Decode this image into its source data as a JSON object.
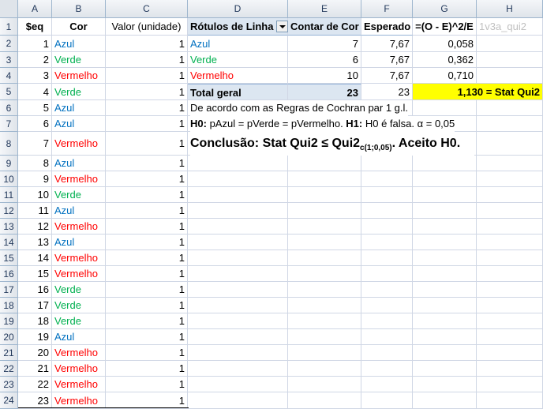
{
  "columns": [
    "A",
    "B",
    "C",
    "D",
    "E",
    "F",
    "G",
    "H"
  ],
  "rows": [
    "1",
    "2",
    "3",
    "4",
    "5",
    "6",
    "7",
    "8",
    "9",
    "10",
    "11",
    "12",
    "13",
    "14",
    "15",
    "16",
    "17",
    "18",
    "19",
    "20",
    "21",
    "22",
    "23",
    "24"
  ],
  "headers": {
    "seq": "$eq",
    "cor": "Cor",
    "valor": "Valor (unidade)",
    "rotulos": "Rótulos de Linha",
    "contar": "Contar de Cor",
    "esperado": "Esperado",
    "formula": "=(O - E)^2/E",
    "h1": "1v3a_qui2"
  },
  "data_rows": [
    {
      "seq": "1",
      "cor": "Azul",
      "valor": "1"
    },
    {
      "seq": "2",
      "cor": "Verde",
      "valor": "1"
    },
    {
      "seq": "3",
      "cor": "Vermelho",
      "valor": "1"
    },
    {
      "seq": "4",
      "cor": "Verde",
      "valor": "1"
    },
    {
      "seq": "5",
      "cor": "Azul",
      "valor": "1"
    },
    {
      "seq": "6",
      "cor": "Azul",
      "valor": "1"
    },
    {
      "seq": "7",
      "cor": "Vermelho",
      "valor": "1"
    },
    {
      "seq": "8",
      "cor": "Azul",
      "valor": "1"
    },
    {
      "seq": "9",
      "cor": "Vermelho",
      "valor": "1"
    },
    {
      "seq": "10",
      "cor": "Verde",
      "valor": "1"
    },
    {
      "seq": "11",
      "cor": "Azul",
      "valor": "1"
    },
    {
      "seq": "12",
      "cor": "Vermelho",
      "valor": "1"
    },
    {
      "seq": "13",
      "cor": "Azul",
      "valor": "1"
    },
    {
      "seq": "14",
      "cor": "Vermelho",
      "valor": "1"
    },
    {
      "seq": "15",
      "cor": "Vermelho",
      "valor": "1"
    },
    {
      "seq": "16",
      "cor": "Verde",
      "valor": "1"
    },
    {
      "seq": "17",
      "cor": "Verde",
      "valor": "1"
    },
    {
      "seq": "18",
      "cor": "Verde",
      "valor": "1"
    },
    {
      "seq": "19",
      "cor": "Azul",
      "valor": "1"
    },
    {
      "seq": "20",
      "cor": "Vermelho",
      "valor": "1"
    },
    {
      "seq": "21",
      "cor": "Vermelho",
      "valor": "1"
    },
    {
      "seq": "22",
      "cor": "Vermelho",
      "valor": "1"
    },
    {
      "seq": "23",
      "cor": "Vermelho",
      "valor": "1"
    }
  ],
  "pivot": [
    {
      "label": "Azul",
      "contar": "7",
      "esperado": "7,67",
      "formula": "0,058"
    },
    {
      "label": "Verde",
      "contar": "6",
      "esperado": "7,67",
      "formula": "0,362"
    },
    {
      "label": "Vermelho",
      "contar": "10",
      "esperado": "7,67",
      "formula": "0,710"
    }
  ],
  "pivot_total": {
    "label": "Total geral",
    "contar": "23",
    "esperado": "23",
    "stat": "1,130 = Stat Qui2"
  },
  "notes": {
    "cochran": "De acordo com as Regras de Cochran par 1 g.l.",
    "h0_label": "H0:",
    "h0_text": " pAzul = pVerde = pVermelho. ",
    "h1_label": "H1:",
    "h1_text": " H0 é falsa. α = 0,05",
    "conclusion_a": "Conclusão: Stat Qui2 ≤ Qui2",
    "conclusion_sub": "c(1;0,05)",
    "conclusion_b": ".  Aceito H0."
  },
  "colors": {
    "azul": "#0070c0",
    "verde": "#00b050",
    "vermelho": "#ff0000",
    "highlight": "#ffff00",
    "pivot": "#dce6f1"
  }
}
